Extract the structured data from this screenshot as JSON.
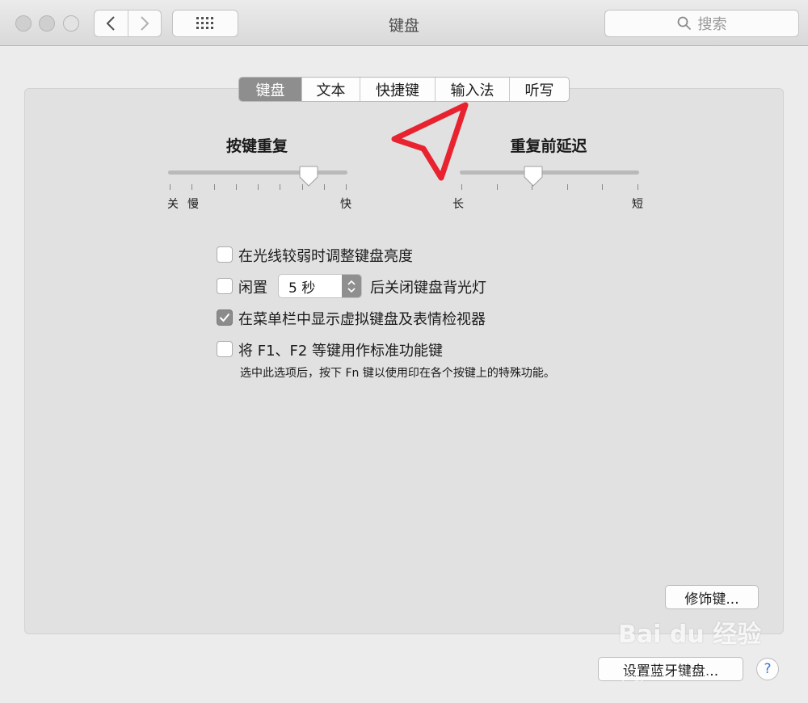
{
  "window": {
    "title": "键盘"
  },
  "toolbar": {
    "search_placeholder": "搜索"
  },
  "tabs": [
    {
      "label": "键盘",
      "active": true
    },
    {
      "label": "文本",
      "active": false
    },
    {
      "label": "快捷键",
      "active": false
    },
    {
      "label": "输入法",
      "active": false
    },
    {
      "label": "听写",
      "active": false
    }
  ],
  "key_repeat": {
    "title": "按键重复",
    "label_off": "关",
    "label_slow": "慢",
    "label_fast": "快",
    "level": 0.82
  },
  "repeat_delay": {
    "title": "重复前延迟",
    "label_long": "长",
    "label_short": "短",
    "level": 0.4
  },
  "options": {
    "adjust_brightness": {
      "label": "在光线较弱时调整键盘亮度",
      "checked": false
    },
    "backlight_off": {
      "label_prefix": "闲置",
      "stepper_value": "5 秒",
      "label_suffix": "后关闭键盘背光灯",
      "checked": false
    },
    "show_viewer": {
      "label": "在菜单栏中显示虚拟键盘及表情检视器",
      "checked": true
    },
    "fn_keys": {
      "label": "将 F1、F2 等键用作标准功能键",
      "hint": "选中此选项后，按下 Fn 键以使用印在各个按键上的特殊功能。",
      "checked": false
    }
  },
  "buttons": {
    "modifier_keys": "修饰键...",
    "bluetooth_keyboard": "设置蓝牙键盘...",
    "help": "?"
  },
  "watermark": {
    "text": "Bai du 经验",
    "sub": "jingyan.baidu.com"
  },
  "colors": {
    "annotation": "#e8232f",
    "active_tab": "#8e8e8e",
    "help_accent": "#3b76d6"
  }
}
